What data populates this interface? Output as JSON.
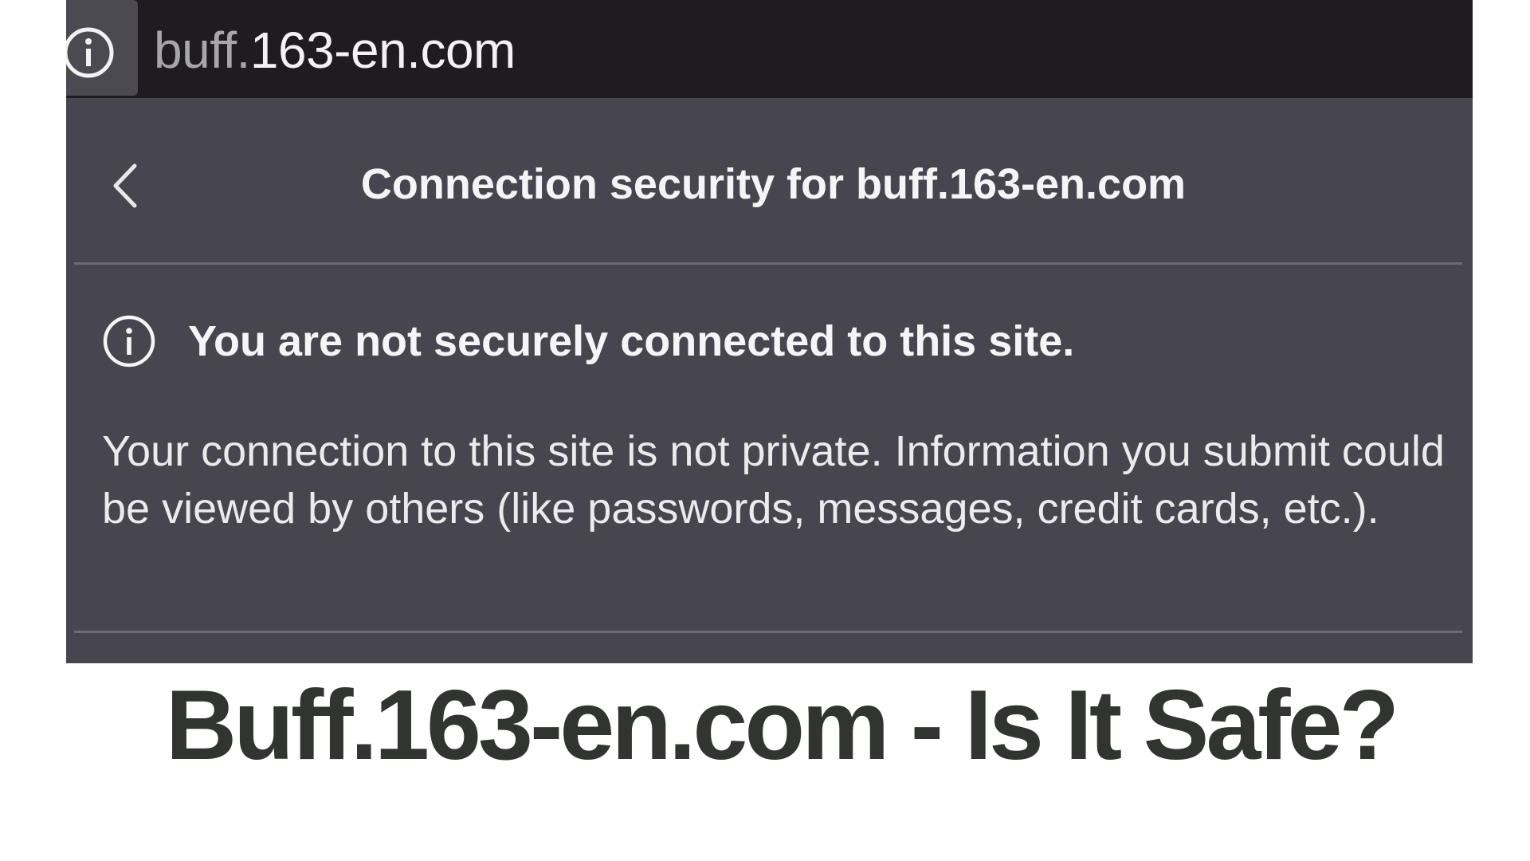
{
  "url_bar": {
    "site_info_icon": "info-circle-icon",
    "url_prefix": "buff.",
    "url_domain": "163-en.com"
  },
  "panel": {
    "back_icon": "chevron-left-icon",
    "title": "Connection security for buff.163-en.com",
    "warning_icon": "info-circle-icon",
    "warning_title": "You are not securely connected to this site.",
    "warning_body": "Your connection to this site is not private. Information you submit could be viewed by others (like passwords, messages, credit cards, etc.)."
  },
  "caption": {
    "text": "Buff.163-en.com - Is It Safe?"
  },
  "colors": {
    "url_bar_bg": "#1e1b21",
    "panel_bg": "#47464f",
    "panel_text": "#f5f5f7",
    "caption_text": "#323432"
  }
}
